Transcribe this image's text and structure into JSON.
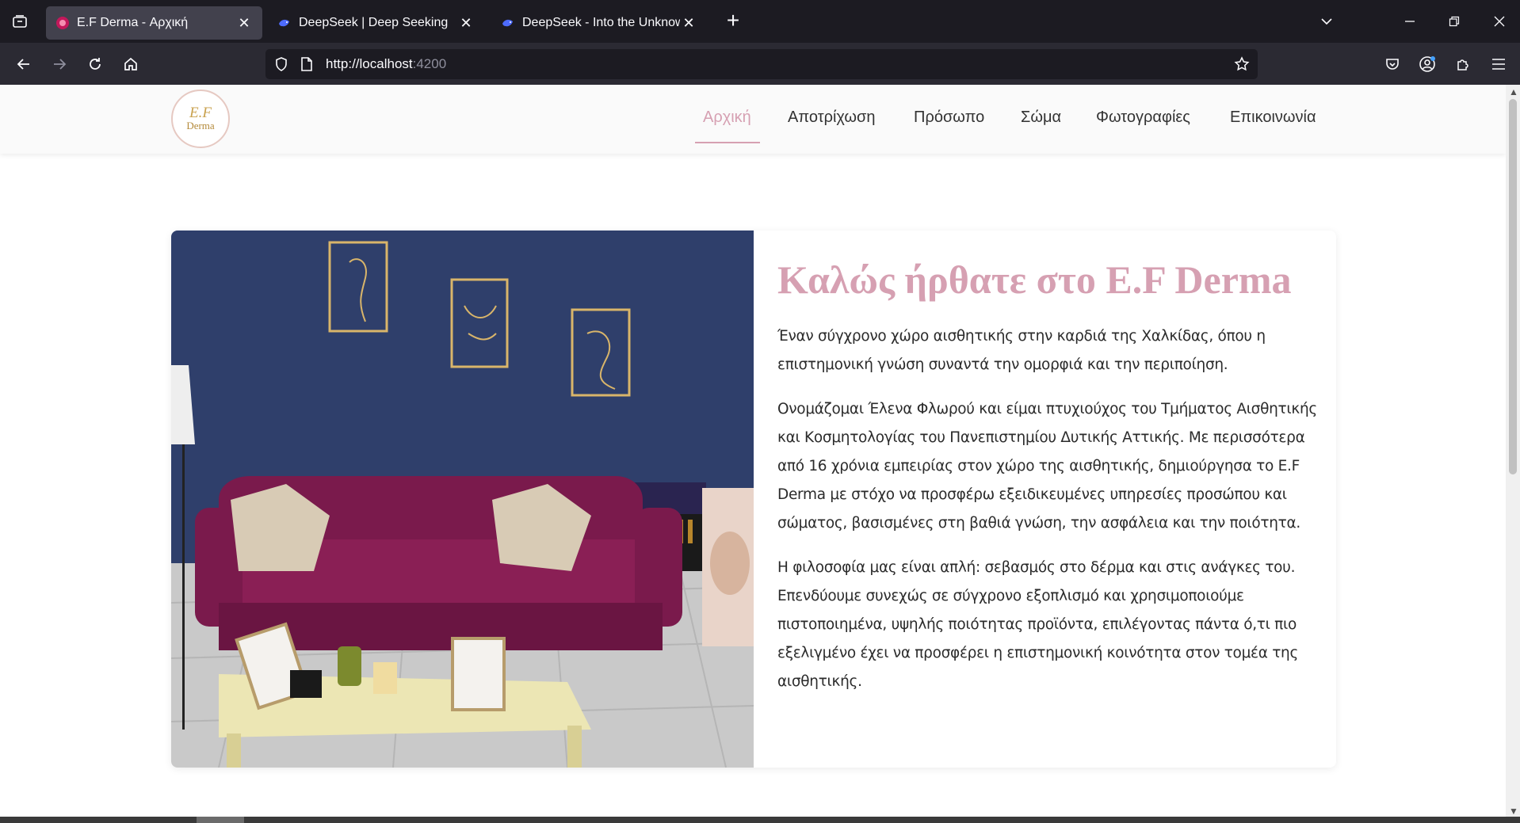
{
  "browser": {
    "tabs": [
      {
        "title": "E.F Derma - Αρχική",
        "active": true,
        "favicon": "ef-derma-favicon"
      },
      {
        "title": "DeepSeek | Deep Seeking",
        "active": false,
        "favicon": "deepseek-whale-icon"
      },
      {
        "title": "DeepSeek - Into the Unknown",
        "active": false,
        "favicon": "deepseek-whale-icon"
      }
    ],
    "url_scheme_host": "http://localhost",
    "url_port": ":4200"
  },
  "site": {
    "logo": {
      "line1": "E.F",
      "line2": "Derma"
    },
    "menu": [
      {
        "label": "Αρχική",
        "active": true
      },
      {
        "label": "Αποτρίχωση",
        "active": false
      },
      {
        "label": "Πρόσωπο",
        "active": false
      },
      {
        "label": "Σώμα",
        "active": false
      },
      {
        "label": "Φωτογραφίες",
        "active": false
      },
      {
        "label": "Επικοινωνία",
        "active": false
      }
    ],
    "hero": {
      "title": "Καλώς ήρθατε στο E.F Derma",
      "paragraphs": [
        "Έναν σύγχρονο χώρο αισθητικής στην καρδιά της Χαλκίδας, όπου η επιστημονική γνώση συναντά την ομορφιά και την περιποίηση.",
        "Ονομάζομαι Έλενα Φλωρού και είμαι πτυχιούχος του Τμήματος Αισθητικής και Κοσμητολογίας του Πανεπιστημίου Δυτικής Αττικής. Με περισσότερα από 16 χρόνια εμπειρίας στον χώρο της αισθητικής, δημιούργησα το E.F Derma με στόχο να προσφέρω εξειδικευμένες υπηρεσίες προσώπου και σώματος, βασισμένες στη βαθιά γνώση, την ασφάλεια και την ποιότητα.",
        "Η φιλοσοφία μας είναι απλή: σεβασμός στο δέρμα και στις ανάγκες του. Επενδύουμε συνεχώς σε σύγχρονο εξοπλισμό και χρησιμοποιούμε πιστοποιημένα, υψηλής ποιότητας προϊόντα, επιλέγοντας πάντα ό,τι πιο εξελιγμένο έχει να προσφέρει η επιστημονική κοινότητα στον τομέα της αισθητικής."
      ]
    }
  },
  "colors": {
    "accent": "#d6a0b2",
    "wall": "#2f3f6b",
    "sofa": "#8a1f55"
  }
}
